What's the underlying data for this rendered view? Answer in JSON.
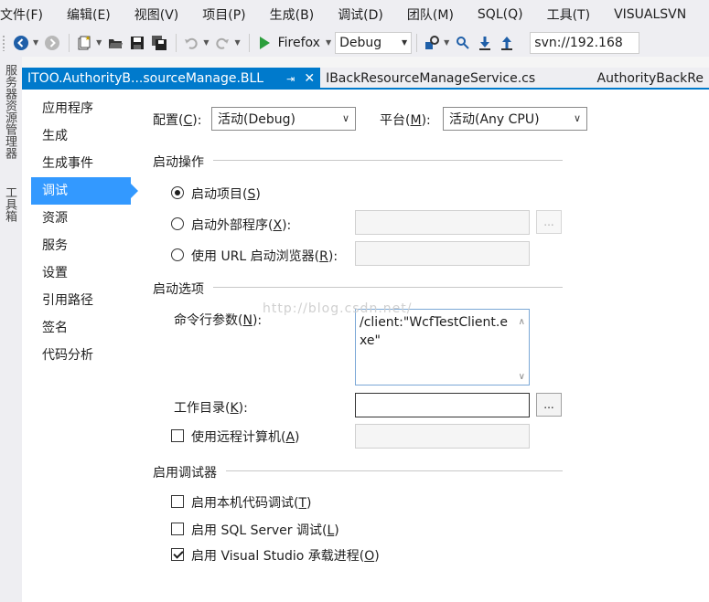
{
  "menubar": {
    "items": [
      "文件(F)",
      "编辑(E)",
      "视图(V)",
      "项目(P)",
      "生成(B)",
      "调试(D)",
      "团队(M)",
      "SQL(Q)",
      "工具(T)",
      "VISUALSVN"
    ]
  },
  "toolbar": {
    "run_label": "Firefox",
    "config_value": "Debug",
    "svn_value": "svn://192.168"
  },
  "side_strip": {
    "server_explorer": "服务器资源管理器",
    "toolbox": "工具箱"
  },
  "tabs": [
    {
      "label": "ITOO.AuthorityB...sourceManage.BLL",
      "active": true
    },
    {
      "label": "IBackResourceManageService.cs",
      "active": false
    },
    {
      "label": "AuthorityBackRe",
      "active": false
    }
  ],
  "nav": {
    "items": [
      "应用程序",
      "生成",
      "生成事件",
      "调试",
      "资源",
      "服务",
      "设置",
      "引用路径",
      "签名",
      "代码分析"
    ],
    "selected_index": 3
  },
  "config_row": {
    "config_label": "配置(",
    "config_key": "C",
    "config_suffix": "):",
    "config_value": "活动(Debug)",
    "platform_label": "平台(",
    "platform_key": "M",
    "platform_suffix": "):",
    "platform_value": "活动(Any CPU)"
  },
  "start_action": {
    "title": "启动操作",
    "options": [
      {
        "label": "启动项目(",
        "key": "S",
        "suffix": ")",
        "checked": true
      },
      {
        "label": "启动外部程序(",
        "key": "X",
        "suffix": "):",
        "checked": false
      },
      {
        "label": "使用 URL 启动浏览器(",
        "key": "R",
        "suffix": "):",
        "checked": false
      }
    ],
    "browse_label": "..."
  },
  "start_options": {
    "title": "启动选项",
    "cmd_label": "命令行参数(",
    "cmd_key": "N",
    "cmd_suffix": "):",
    "cmd_value": "/client:\"WcfTestClient.exe\"",
    "workdir_label": "工作目录(",
    "workdir_key": "K",
    "workdir_suffix": "):",
    "workdir_value": "",
    "browse_label": "...",
    "remote_label": "使用远程计算机(",
    "remote_key": "A",
    "remote_suffix": ")",
    "remote_checked": false
  },
  "enable_debuggers": {
    "title": "启用调试器",
    "options": [
      {
        "label": "启用本机代码调试(",
        "key": "T",
        "suffix": ")",
        "checked": false
      },
      {
        "label": "启用 SQL Server 调试(",
        "key": "L",
        "suffix": ")",
        "checked": false
      },
      {
        "label": "启用 Visual Studio 承载进程(",
        "key": "O",
        "suffix": ")",
        "checked": true
      }
    ]
  },
  "watermark": "http://blog.csdn.net/",
  "colors": {
    "accent": "#007acc",
    "nav_selected": "#3399ff"
  }
}
